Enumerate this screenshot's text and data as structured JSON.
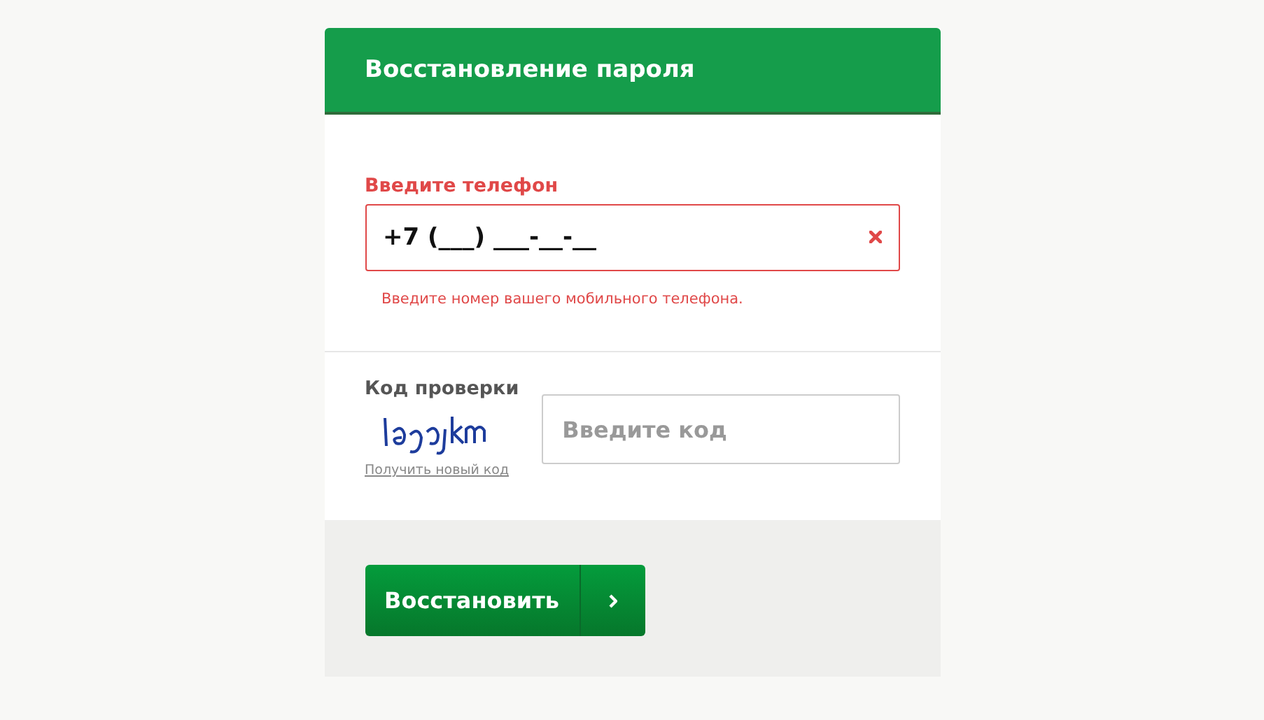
{
  "title": "Восстановление пароля",
  "phone": {
    "label": "Введите телефон",
    "value": "+7 (___) ___-__-__",
    "error": true,
    "error_message": "Введите номер вашего мобильного телефона."
  },
  "captcha": {
    "label": "Код проверки",
    "refresh_link": "Получить новый код",
    "placeholder": "Введите код"
  },
  "submit_button": "Восстановить"
}
